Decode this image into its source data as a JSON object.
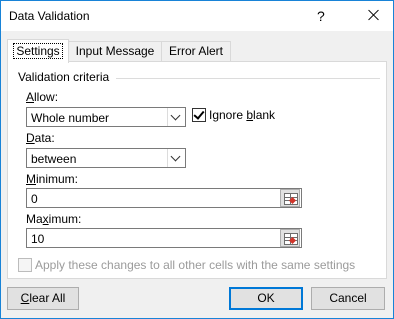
{
  "window": {
    "title": "Data Validation",
    "help_glyph": "?"
  },
  "tabs": [
    {
      "label": "Settings",
      "active": true
    },
    {
      "label": "Input Message",
      "active": false
    },
    {
      "label": "Error Alert",
      "active": false
    }
  ],
  "settings": {
    "group_title": "Validation criteria",
    "allow": {
      "label_prefix": "",
      "label_key": "A",
      "label_rest": "llow:",
      "value": "Whole number"
    },
    "ignore_blank": {
      "label_pre": "Ignore ",
      "label_key": "b",
      "label_rest": "lank",
      "checked": true
    },
    "data": {
      "label_key": "D",
      "label_rest": "ata:",
      "value": "between"
    },
    "minimum": {
      "label_key": "M",
      "label_rest": "inimum:",
      "value": "0"
    },
    "maximum": {
      "label_pre": "Ma",
      "label_key": "x",
      "label_rest": "imum:",
      "value": "10"
    },
    "apply_all": {
      "label": "Apply these changes to all other cells with the same settings",
      "checked": false,
      "enabled": false
    }
  },
  "buttons": {
    "clear_all_key": "C",
    "clear_all_rest": "lear All",
    "ok": "OK",
    "cancel": "Cancel"
  },
  "colors": {
    "accent": "#0078d7",
    "dialog_border": "#1883d7"
  }
}
